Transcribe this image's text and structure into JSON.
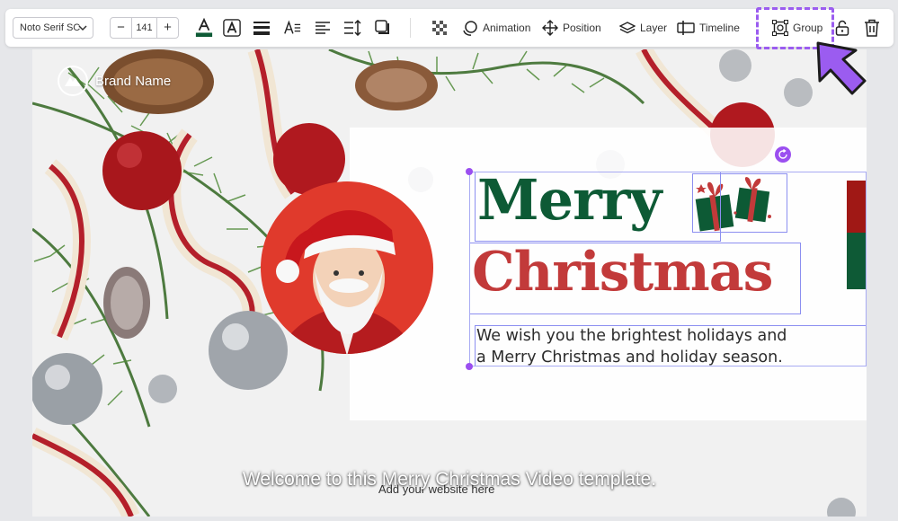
{
  "toolbar": {
    "font_family": "Noto Serif SC",
    "font_size": "141",
    "minus_label": "−",
    "plus_label": "+",
    "text_color": "#0d5a35",
    "animation_label": "Animation",
    "position_label": "Position",
    "layer_label": "Layer",
    "timeline_label": "Timeline",
    "group_label": "Group",
    "highlight_color": "#9b5cf0"
  },
  "canvas": {
    "brand_name": "Brand Name",
    "heading_line1": "Merry",
    "heading_line2": "Christmas",
    "body_line1": "We wish you the brightest holidays and",
    "body_line2": "a Merry Christmas and holiday season.",
    "caption": "Welcome to this Merry Christmas Video template.",
    "website": "Add your website here",
    "colors": {
      "green": "#0d5a35",
      "red": "#c23a3a"
    }
  }
}
